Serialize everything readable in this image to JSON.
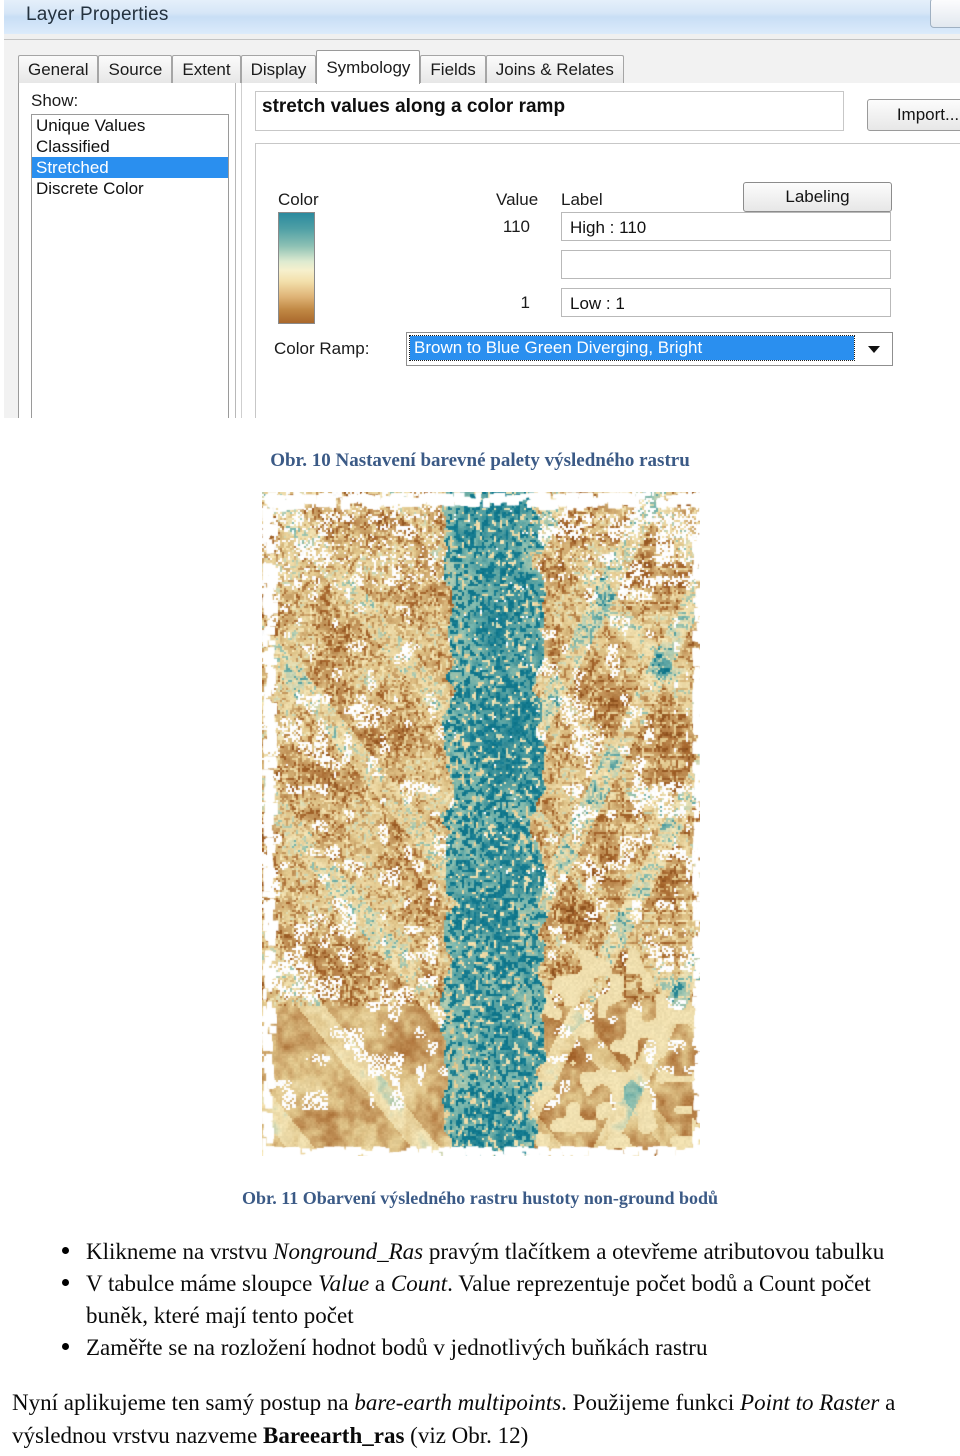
{
  "dialog": {
    "title": "Layer Properties",
    "window_button": "restore-button",
    "tabs": [
      {
        "label": "General",
        "active": false
      },
      {
        "label": "Source",
        "active": false
      },
      {
        "label": "Extent",
        "active": false
      },
      {
        "label": "Display",
        "active": false
      },
      {
        "label": "Symbology",
        "active": true
      },
      {
        "label": "Fields",
        "active": false
      },
      {
        "label": "Joins & Relates",
        "active": false
      }
    ],
    "show_label": "Show:",
    "show_items": [
      {
        "label": "Unique Values",
        "selected": false
      },
      {
        "label": "Classified",
        "selected": false
      },
      {
        "label": "Stretched",
        "selected": true
      },
      {
        "label": "Discrete Color",
        "selected": false
      }
    ],
    "method_description": "stretch values along a color ramp",
    "import_button": "Import...",
    "columns": {
      "color": "Color",
      "value": "Value",
      "label": "Label"
    },
    "labeling_button": "Labeling",
    "rows": [
      {
        "value": "110",
        "label": "High : 110"
      },
      {
        "value": "",
        "label": ""
      },
      {
        "value": "1",
        "label": "Low : 1"
      }
    ],
    "color_ramp_label": "Color Ramp:",
    "color_ramp_selected": "Brown to Blue Green Diverging, Bright",
    "colors": {
      "ramp_high": "#2b8a9e",
      "ramp_mid": "#f6f0cd",
      "ramp_low": "#a9672b",
      "selection_blue": "#2a8fef",
      "titlebar_blue": "#c8deF5"
    }
  },
  "figures": {
    "caption_10": "Obr. 10 Nastavení barevné palety výsledného rastru",
    "caption_11": "Obr. 11 Obarvení výsledného rastru hustoty non-ground bodů",
    "raster": {
      "alt": "non-ground point density raster rendered with brown to blue green diverging ramp",
      "colors": {
        "teal": "#12798e",
        "teal_light": "#7fb8ac",
        "cream": "#f2e3b4",
        "tan": "#e0c58a",
        "brown": "#a5642b",
        "dark_brown": "#8a4f1d",
        "background": "#ffffff"
      }
    }
  },
  "body": {
    "bullets": [
      {
        "parts": [
          {
            "text": "Klikneme na vrstvu ",
            "style": "normal"
          },
          {
            "text": "Nonground_Ras",
            "style": "italic"
          },
          {
            "text": " pravým tlačítkem a otevřeme atributovou tabulku",
            "style": "normal"
          }
        ]
      },
      {
        "parts": [
          {
            "text": "V tabulce máme sloupce ",
            "style": "normal"
          },
          {
            "text": "Value",
            "style": "italic"
          },
          {
            "text": " a ",
            "style": "normal"
          },
          {
            "text": "Count",
            "style": "italic"
          },
          {
            "text": ". Value reprezentuje počet bodů a Count počet",
            "style": "normal"
          }
        ],
        "continuation": "buněk, které mají tento počet"
      },
      {
        "parts": [
          {
            "text": "Zaměřte se na rozložení hodnot bodů v jednotlivých buňkách rastru",
            "style": "normal"
          }
        ]
      }
    ],
    "paragraph": [
      {
        "text": "Nyní aplikujeme ten samý postup na ",
        "style": "normal"
      },
      {
        "text": "bare-earth multipoints",
        "style": "italic"
      },
      {
        "text": ". Použijeme funkci ",
        "style": "normal"
      },
      {
        "text": "Point to Raster",
        "style": "italic"
      },
      {
        "text": " a výslednou vrstvu nazveme ",
        "style": "normal"
      },
      {
        "text": "Bareearth_ras",
        "style": "bold"
      },
      {
        "text": " (viz Obr. 12)",
        "style": "normal"
      }
    ]
  }
}
